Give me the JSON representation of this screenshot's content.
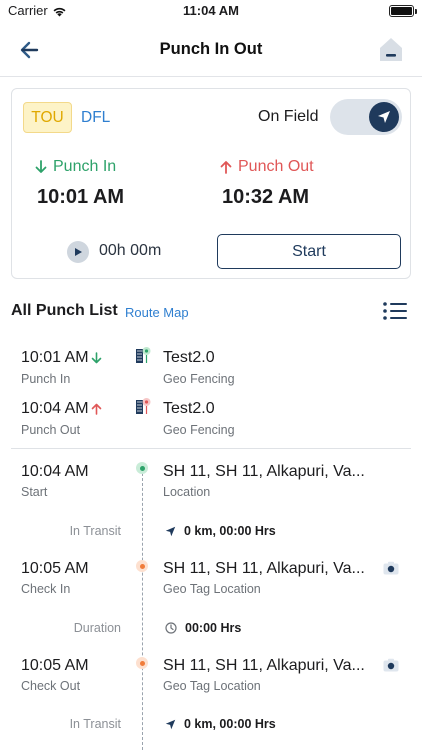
{
  "status_bar": {
    "carrier": "Carrier",
    "time": "11:04 AM"
  },
  "header": {
    "title": "Punch In Out",
    "back_icon": "back-arrow-icon",
    "home_icon": "home-icon"
  },
  "summary": {
    "tags": [
      "TOU",
      "DFL"
    ],
    "on_field_label": "On Field",
    "on_field_enabled": true,
    "punch_in": {
      "label": "Punch In",
      "time": "10:01 AM",
      "color": "#2ea26a"
    },
    "punch_out": {
      "label": "Punch Out",
      "time": "10:32 AM",
      "color": "#e05757"
    },
    "timer": "00h 00m",
    "start_button": "Start"
  },
  "list": {
    "title": "All Punch List",
    "route_map": "Route Map",
    "punch_rows": [
      {
        "time": "10:01 AM",
        "type": "Punch In",
        "name": "Test2.0",
        "desc": "Geo Fencing"
      },
      {
        "time": "10:04 AM",
        "type": "Punch Out",
        "name": "Test2.0",
        "desc": "Geo Fencing"
      }
    ],
    "timeline": [
      {
        "time": "10:04 AM",
        "type": "Start",
        "location": "SH 11, SH 11, Alkapuri, Va...",
        "desc": "Location",
        "dot_color": "#2ea26a"
      },
      {
        "label": "In Transit",
        "value": "0 km, 00:00 Hrs",
        "icon": "navigation-arrow-icon"
      },
      {
        "time": "10:05 AM",
        "type": "Check In",
        "location": "SH 11, SH 11, Alkapuri, Va...",
        "desc": "Geo Tag Location",
        "dot_color": "#f07c3b"
      },
      {
        "label": "Duration",
        "value": "00:00 Hrs",
        "icon": "clock-icon"
      },
      {
        "time": "10:05 AM",
        "type": "Check Out",
        "location": "SH 11, SH 11, Alkapuri, Va...",
        "desc": "Geo Tag Location",
        "dot_color": "#f07c3b"
      },
      {
        "label": "In Transit",
        "value": "0 km, 00:00 Hrs",
        "icon": "navigation-arrow-icon"
      }
    ]
  },
  "colors": {
    "primary": "#1f3a5c",
    "link": "#2f7fd0",
    "tag_bg": "#fdf3c7",
    "tag_text": "#e0a800"
  }
}
